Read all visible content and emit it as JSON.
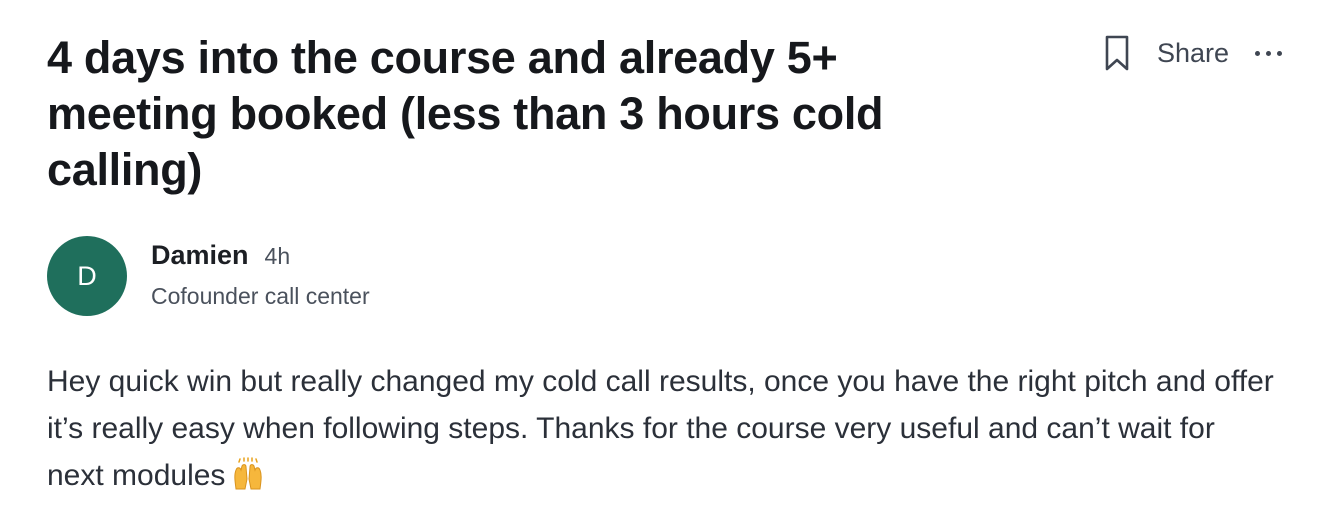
{
  "post": {
    "title": "4 days into the course and already 5+ meeting booked (less than 3 hours cold calling)",
    "actions": {
      "share_label": "Share",
      "bookmark_icon": "bookmark-icon",
      "more_icon": "more-horizontal-icon"
    },
    "author": {
      "initial": "D",
      "name": "Damien",
      "time": "4h",
      "role": "Cofounder call center",
      "avatar_color": "#1f6f5c"
    },
    "body": "Hey quick win but really changed my cold call results, once you have the right pitch and offer it’s really easy when following steps. Thanks for the course very useful and can’t wait for next modules",
    "body_emoji": "raising-hands-emoji"
  }
}
